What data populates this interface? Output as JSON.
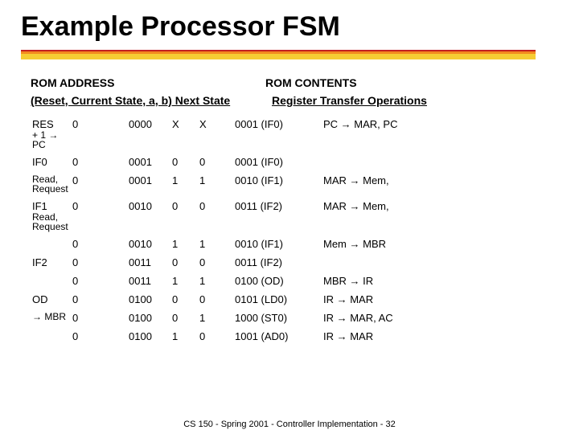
{
  "title": "Example Processor FSM",
  "headers": {
    "rom_address": "ROM ADDRESS",
    "rom_contents": "ROM CONTENTS",
    "address_cols": "(Reset, Current State, a, b) Next State",
    "ops_col": "Register Transfer Operations"
  },
  "rows": [
    {
      "state": "RES",
      "state_extra": "+ 1 → PC",
      "reset": "0",
      "curr": "0000",
      "a": "X",
      "b": "X",
      "next": "0001 (IF0)",
      "ops": "PC → MAR, PC"
    },
    {
      "state": "IF0",
      "state_extra": "",
      "reset": "0",
      "curr": "0001",
      "a": "0",
      "b": "0",
      "next": "0001 (IF0)",
      "ops": ""
    },
    {
      "state": "",
      "state_extra": "Read, Request",
      "reset": "0",
      "curr": "0001",
      "a": "1",
      "b": "1",
      "next": "0010 (IF1)",
      "ops": "MAR → Mem,"
    },
    {
      "state": "IF1",
      "state_extra": "Read, Request",
      "reset": "0",
      "curr": "0010",
      "a": "0",
      "b": "0",
      "next": "0011 (IF2)",
      "ops": "MAR → Mem,"
    },
    {
      "state": "",
      "state_extra": "",
      "reset": "0",
      "curr": "0010",
      "a": "1",
      "b": "1",
      "next": "0010 (IF1)",
      "ops": "Mem → MBR"
    },
    {
      "state": "IF2",
      "state_extra": "",
      "reset": "0",
      "curr": "0011",
      "a": "0",
      "b": "0",
      "next": "0011 (IF2)",
      "ops": ""
    },
    {
      "state": "",
      "state_extra": "",
      "reset": "0",
      "curr": "0011",
      "a": "1",
      "b": "1",
      "next": "0100 (OD)",
      "ops": "MBR → IR"
    },
    {
      "state": "OD",
      "state_extra": "",
      "reset": "0",
      "curr": "0100",
      "a": "0",
      "b": "0",
      "next": "0101 (LD0)",
      "ops": "IR → MAR"
    },
    {
      "state": "",
      "state_extra": "→ MBR",
      "reset": "0",
      "curr": "0100",
      "a": "0",
      "b": "1",
      "next": "1000 (ST0)",
      "ops": "IR → MAR, AC"
    },
    {
      "state": "",
      "state_extra": "",
      "reset": "0",
      "curr": "0100",
      "a": "1",
      "b": "0",
      "next": "1001 (AD0)",
      "ops": "IR → MAR"
    }
  ],
  "footer": "CS 150 - Spring 2001 - Controller Implementation - 32"
}
